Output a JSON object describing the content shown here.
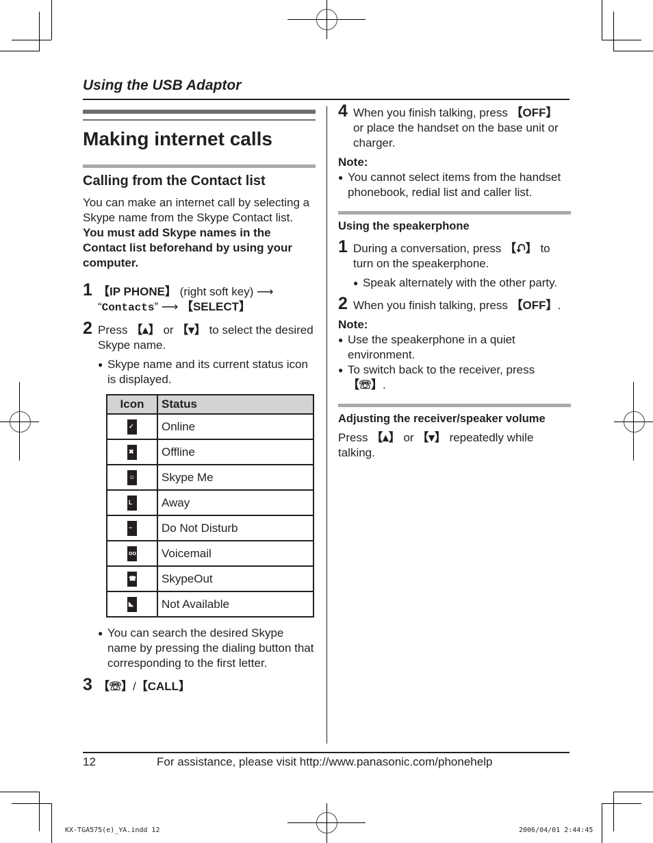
{
  "header": {
    "running_title": "Using the USB Adaptor"
  },
  "left": {
    "title": "Making internet calls",
    "subtitle": "Calling from the Contact list",
    "intro": "You can make an internet call by selecting a Skype name from the Skype Contact list.",
    "intro_bold": "You must add Skype names in the Contact list beforehand by using your computer.",
    "step1": {
      "num": "1",
      "key1": "【IP PHONE】",
      "text1": " (right soft key) ⟶ ",
      "quote_open": "“",
      "mono": "Contacts",
      "quote_close": "” ⟶ ",
      "key2": "【SELECT】"
    },
    "step2": {
      "num": "2",
      "pre": "Press ",
      "key_up": "【▴】",
      "mid": " or ",
      "key_down": "【▾】",
      "post": " to select the desired Skype name.",
      "bullet": "Skype name and its current status icon is displayed."
    },
    "table": {
      "headers": [
        "Icon",
        "Status"
      ],
      "rows": [
        {
          "icon": "online-icon",
          "glyph": "✓",
          "status": "Online"
        },
        {
          "icon": "offline-icon",
          "glyph": "✖",
          "status": "Offline"
        },
        {
          "icon": "skype-me-icon",
          "glyph": "☺",
          "status": "Skype Me"
        },
        {
          "icon": "away-icon",
          "glyph": "L",
          "status": "Away"
        },
        {
          "icon": "do-not-disturb-icon",
          "glyph": "−",
          "status": "Do Not Disturb"
        },
        {
          "icon": "voicemail-icon",
          "glyph": "oo",
          "status": "Voicemail"
        },
        {
          "icon": "skypeout-icon",
          "glyph": "☎",
          "status": "SkypeOut"
        },
        {
          "icon": "not-available-icon",
          "glyph": "◣",
          "status": "Not Available"
        }
      ]
    },
    "bullet_search": "You can search the desired Skype name by pressing the dialing button that corresponding to the first letter.",
    "step3": {
      "num": "3",
      "key_talk": "【☏】",
      "sep": "/",
      "key_call": "【CALL】"
    }
  },
  "right": {
    "step4": {
      "num": "4",
      "pre": "When you finish talking, press ",
      "key": "【OFF】",
      "post": " or place the handset on the base unit or charger."
    },
    "note1_label": "Note:",
    "note1_bullet": "You cannot select items from the handset phonebook, redial list and caller list.",
    "speaker_heading": "Using the speakerphone",
    "sp_step1": {
      "num": "1",
      "pre": "During a conversation, press ",
      "key": "【⮏】",
      "post": " to turn on the speakerphone.",
      "bullet": "Speak alternately with the other party."
    },
    "sp_step2": {
      "num": "2",
      "pre": "When you finish talking, press ",
      "key": "【OFF】",
      "post": "."
    },
    "note2_label": "Note:",
    "note2_bullets": [
      "Use the speakerphone in a quiet environment.",
      "To switch back to the receiver, press"
    ],
    "note2_key": "【☏】",
    "note2_end": ".",
    "volume_heading": "Adjusting the receiver/speaker volume",
    "volume_text": {
      "pre": "Press ",
      "key_up": "【▴】",
      "mid": " or ",
      "key_down": "【▾】",
      "post": " repeatedly while talking."
    }
  },
  "footer": {
    "page_number": "12",
    "assist": "For assistance, please visit http://www.panasonic.com/phonehelp"
  },
  "slug": {
    "file": "KX-TGA575(e)_YA.indd   12",
    "datetime": "2006/04/01   2:44:45"
  }
}
